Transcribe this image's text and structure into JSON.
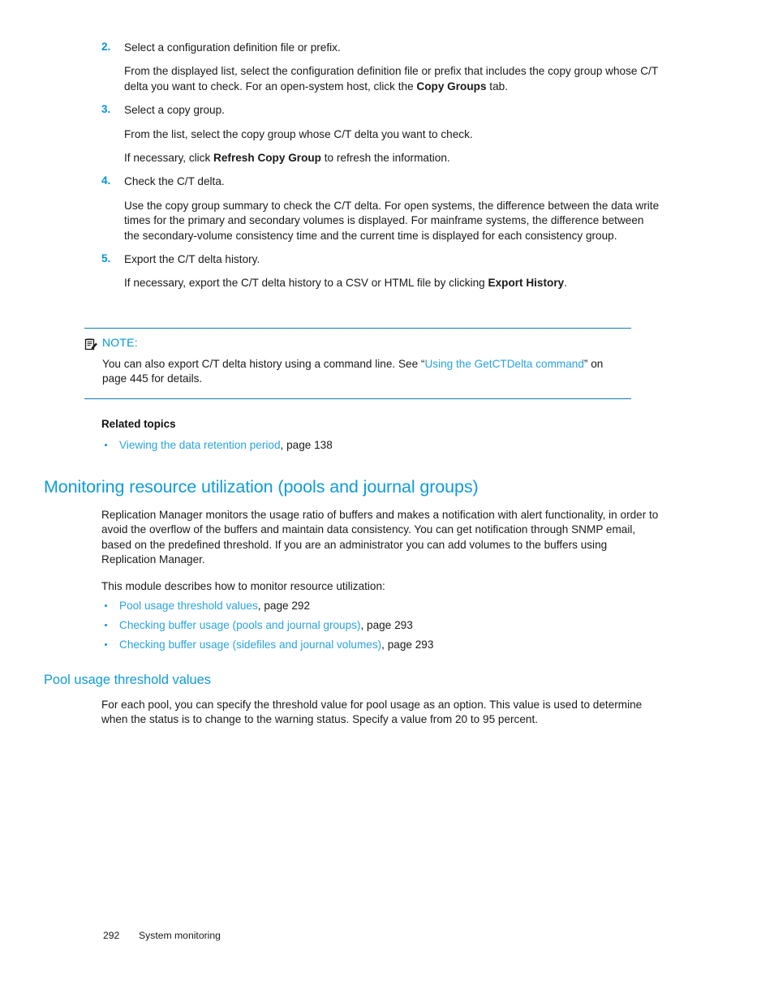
{
  "accent_blue": "#0096d6",
  "link_blue": "#2aa3dd",
  "rule_blue": "#0c7cb4",
  "steps": [
    {
      "number": "2.",
      "title": "Select a configuration definition file or prefix.",
      "para_a": "From the displayed list, select the configuration definition file or prefix that includes the copy group whose C/T delta you want to check. For an open-system host, click the ",
      "para_a_bold": "Copy Groups",
      "para_a_tail": " tab."
    },
    {
      "number": "3.",
      "title": "Select a copy group.",
      "para_a": "From the list, select the copy group whose C/T delta you want to check.",
      "para_b_lead": "If necessary, click ",
      "para_b_bold": "Refresh Copy Group",
      "para_b_tail": " to refresh the information."
    },
    {
      "number": "4.",
      "title": "Check the C/T delta.",
      "para_a": "Use the copy group summary to check the C/T delta. For open systems, the difference between the data write times for the primary and secondary volumes is displayed. For mainframe systems, the difference between the secondary-volume consistency time and the current time is displayed for each consistency group."
    },
    {
      "number": "5.",
      "title": "Export the C/T delta history.",
      "para_a_lead": "If necessary, export the C/T delta history to a CSV or HTML file by clicking ",
      "para_a_bold": "Export History",
      "para_a_tail": "."
    }
  ],
  "note": {
    "icon": "note-pencil-icon",
    "label": "NOTE:",
    "text_lead": "You can also export C/T delta history using a command line. See “",
    "link": "Using the GetCTDelta command",
    "text_tail": "” on page 445 for details."
  },
  "related": {
    "title": "Related topics",
    "items": [
      {
        "link": "Viewing the data retention period",
        "tail": ", page 138"
      }
    ]
  },
  "section": {
    "heading": "Monitoring resource utilization (pools and journal groups)",
    "para1": "Replication Manager monitors the usage ratio of buffers and makes a notification with alert functionality, in order to avoid the overflow of the buffers and maintain data consistency. You can get notification through SNMP email, based on the predefined threshold. If you are an administrator you can add volumes to the buffers using Replication Manager.",
    "para2": "This module describes how to monitor resource utilization:",
    "links": [
      {
        "link": "Pool usage threshold values",
        "tail": ", page 292"
      },
      {
        "link": "Checking buffer usage (pools and journal groups)",
        "tail": ", page 293"
      },
      {
        "link": "Checking buffer usage (sidefiles and journal volumes)",
        "tail": ", page 293"
      }
    ]
  },
  "subsection": {
    "heading": "Pool usage threshold values",
    "para1": "For each pool, you can specify the threshold value for pool usage as an option. This value is used to determine when the status is to change to the warning status. Specify a value from 20 to 95 percent."
  },
  "footer": {
    "page_number": "292",
    "section_name": "System monitoring"
  }
}
